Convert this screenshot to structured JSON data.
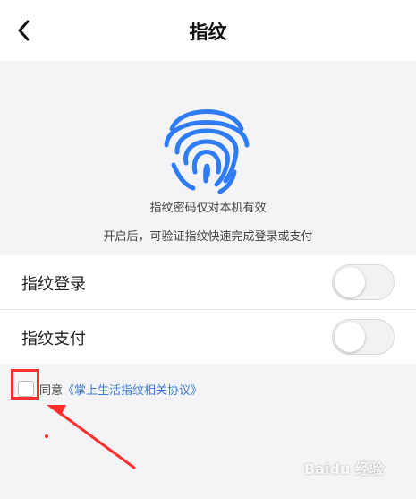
{
  "header": {
    "title": "指纹",
    "back_icon": "chevron-left-icon"
  },
  "hero": {
    "icon": "fingerprint-icon",
    "note_1": "指纹密码仅对本机有效",
    "note_2": "开启后，可验证指纹快速完成登录或支付",
    "accent": "#2f7cf6"
  },
  "settings": {
    "items": [
      {
        "label": "指纹登录",
        "enabled": false
      },
      {
        "label": "指纹支付",
        "enabled": false
      }
    ]
  },
  "agreement": {
    "prefix": "同意",
    "link": "《掌上生活指纹相关协议》",
    "checked": false
  },
  "watermark": "Baidu 经验",
  "colors": {
    "annotation_red": "#ff2e2e",
    "link_blue": "#3a7bd5"
  }
}
